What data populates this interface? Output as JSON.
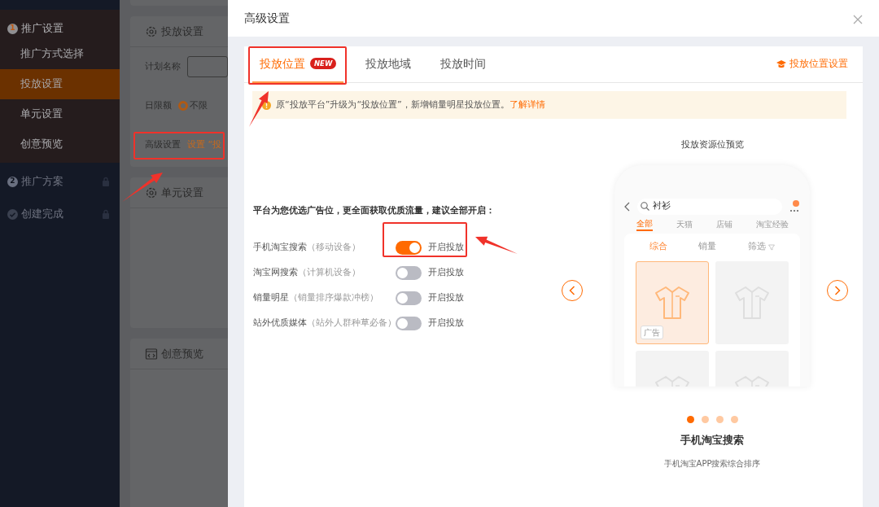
{
  "sidebar": {
    "steps": [
      {
        "kind": "number",
        "number": "1",
        "label": "推广设置",
        "expanded": true,
        "locked": false,
        "children": [
          {
            "label": "推广方式选择",
            "selected": false
          },
          {
            "label": "投放设置",
            "selected": true
          },
          {
            "label": "单元设置",
            "selected": false
          },
          {
            "label": "创意预览",
            "selected": false
          }
        ]
      },
      {
        "kind": "number",
        "number": "2",
        "label": "推广方案",
        "expanded": false,
        "locked": true
      },
      {
        "kind": "done",
        "label": "创建完成",
        "expanded": false,
        "locked": true
      }
    ]
  },
  "background_page": {
    "sections": [
      {
        "title": "投放设置",
        "fields": [
          {
            "kind": "input",
            "label": "计划名称"
          },
          {
            "kind": "radio",
            "label": "日限额",
            "option": "不限",
            "checked": true
          },
          {
            "kind": "link",
            "label": "高级设置",
            "value": "设置 “投"
          }
        ]
      },
      {
        "title": "单元设置"
      },
      {
        "title": "创意预览"
      }
    ]
  },
  "dialog": {
    "title": "高级设置",
    "tabs": [
      {
        "label": "投放位置",
        "badge": "NEW",
        "selected": true
      },
      {
        "label": "投放地域",
        "selected": false
      },
      {
        "label": "投放时间",
        "selected": false
      }
    ],
    "help_link": "投放位置设置",
    "notice": {
      "text": "原“投放平台”升级为“投放位置”，新增销量明星投放位置。",
      "link": "了解详情"
    },
    "intro": "平台为您优选广告位，更全面获取优质流量，建议全部开启：",
    "placements": [
      {
        "name": "手机淘宝搜索",
        "note": "（移动设备）",
        "on": true,
        "label": "开启投放"
      },
      {
        "name": "淘宝网搜索",
        "note": "（计算机设备）",
        "on": false,
        "label": "开启投放"
      },
      {
        "name": "销量明星",
        "note": "（销量排序爆款冲榜）",
        "on": false,
        "label": "开启投放"
      },
      {
        "name": "站外优质媒体",
        "note": "（站外人群种草必备）",
        "on": false,
        "label": "开启投放"
      }
    ],
    "preview": {
      "title": "投放资源位预览",
      "phone": {
        "search": "衬衫",
        "tabs": [
          {
            "label": "全部",
            "selected": true
          },
          {
            "label": "天猫",
            "selected": false
          },
          {
            "label": "店铺",
            "selected": false
          },
          {
            "label": "淘宝经验",
            "selected": false
          }
        ],
        "sort": [
          {
            "label": "综合",
            "selected": true
          },
          {
            "label": "销量",
            "selected": false
          },
          {
            "label": "筛选",
            "selected": false,
            "filter": true
          }
        ],
        "products": [
          {
            "ad": true,
            "ad_label": "广告"
          },
          {
            "ad": false
          },
          {
            "ad": false
          },
          {
            "ad": false
          }
        ]
      },
      "dots": [
        {
          "selected": true
        },
        {
          "selected": false
        },
        {
          "selected": false
        },
        {
          "selected": false
        }
      ],
      "caption": "手机淘宝搜索",
      "description": "手机淘宝APP搜索综合排序"
    }
  }
}
